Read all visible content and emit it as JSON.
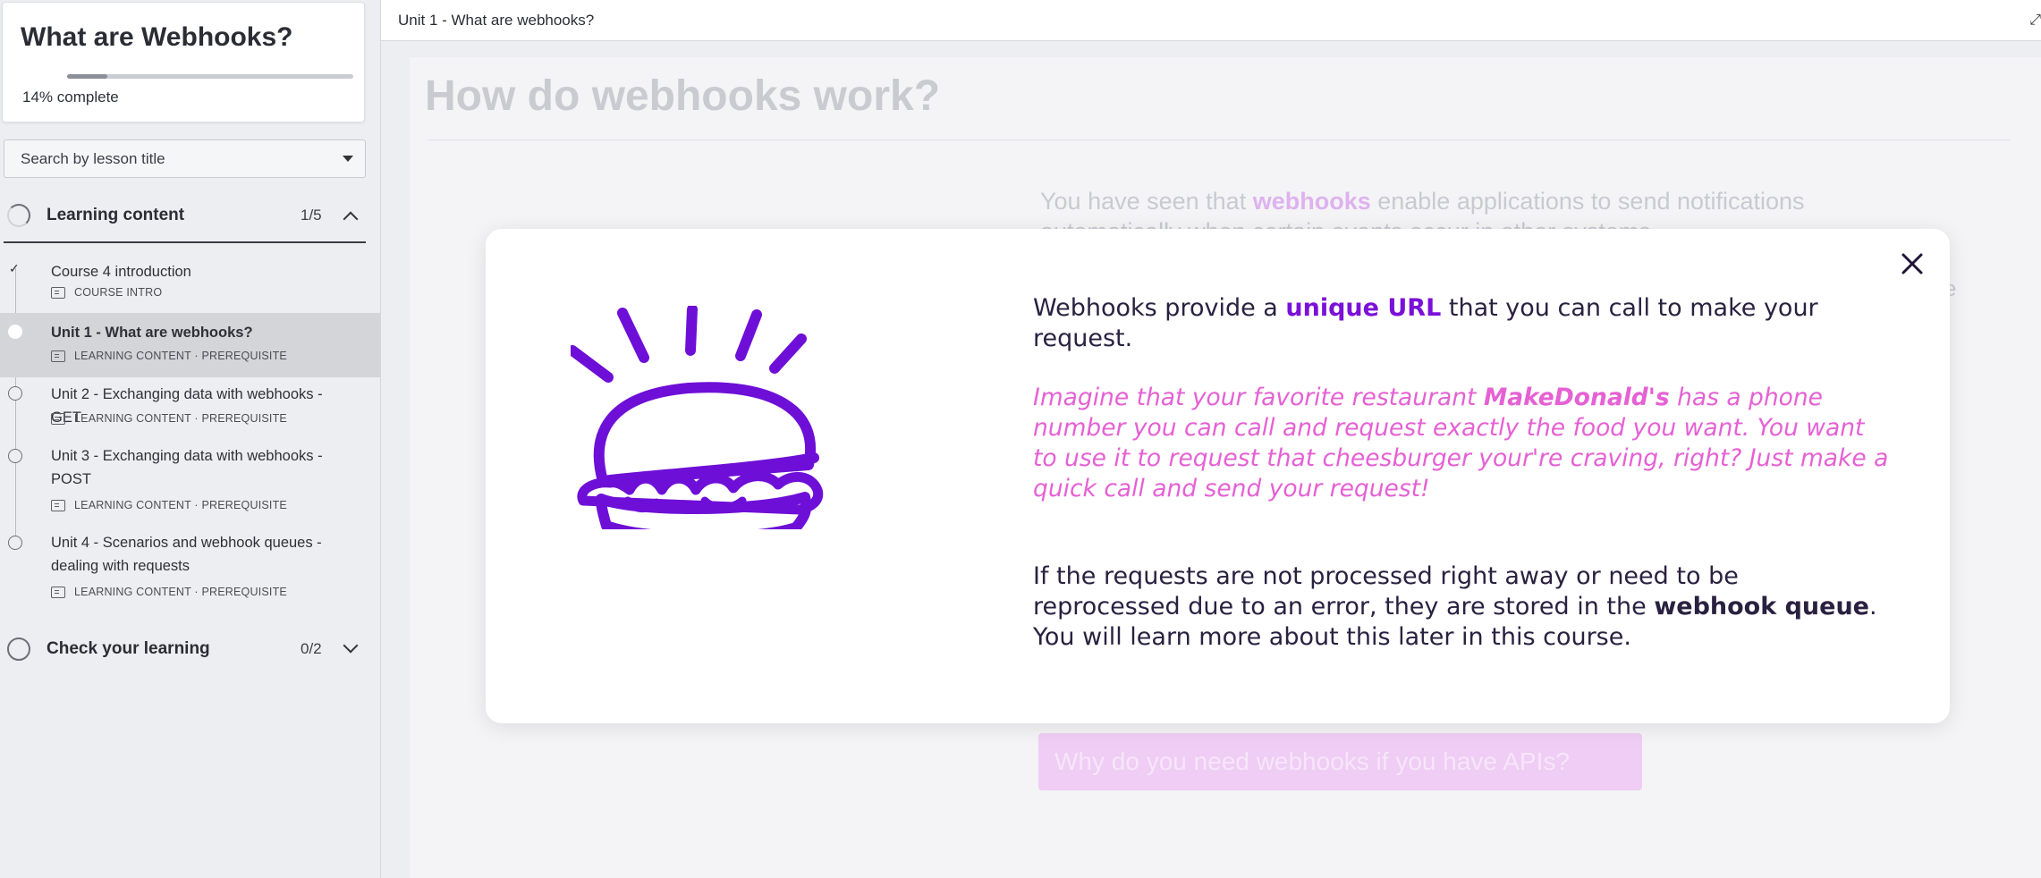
{
  "sidebar": {
    "course_title": "What are Webhooks?",
    "progress_percent_label": "14%",
    "progress_suffix": "complete",
    "progress_fraction": 0.14,
    "search_placeholder": "Search by lesson title",
    "sections": [
      {
        "label": "Learning content",
        "count": "1/5"
      },
      {
        "label": "Check your learning",
        "count": "0/2"
      }
    ],
    "lessons": [
      {
        "title": "Course 4 introduction",
        "meta": "COURSE INTRO",
        "state": "complete"
      },
      {
        "title": "Unit 1 - What are webhooks?",
        "meta": "LEARNING CONTENT · PREREQUISITE",
        "state": "active"
      },
      {
        "title": "Unit 2 - Exchanging data with webhooks - GET",
        "meta": "LEARNING CONTENT · PREREQUISITE",
        "state": "todo"
      },
      {
        "title": "Unit 3 - Exchanging data with webhooks - POST",
        "meta": "LEARNING CONTENT · PREREQUISITE",
        "state": "todo"
      },
      {
        "title": "Unit 4 - Scenarios and webhook queues - dealing with requests",
        "meta": "LEARNING CONTENT · PREREQUISITE",
        "state": "todo"
      }
    ]
  },
  "topbar": {
    "breadcrumb": "Unit 1 - What are webhooks?"
  },
  "background": {
    "heading": "How do webhooks work?",
    "intro_before": "You have seen that ",
    "intro_highlight": "webhooks",
    "intro_after": " enable applications to send notifications",
    "intro_line2": "automatically when certain events occur in other systems.",
    "fragment": "e",
    "button_label": "Why do you need webhooks if you have APIs?"
  },
  "modal": {
    "p1_before": "Webhooks provide a ",
    "p1_highlight": "unique URL",
    "p1_after": " that you can call to make your request.",
    "p2_before": "Imagine that your favorite restaurant ",
    "p2_brand": "MakeDonald's",
    "p2_after": " has a phone number you can call and request exactly the food you want. You want to use it to request that cheesburger your're craving, right? Just make a quick call and send your request!",
    "p3_before": "If the requests are not processed right away or need to be reprocessed due to an error, they are stored in the ",
    "p3_bold": "webhook queue",
    "p3_after": ". You will learn more about this later in this course.",
    "illustration_icon": "burger-icon",
    "close_icon": "close-icon"
  },
  "colors": {
    "accent_purple": "#7b10d8",
    "accent_pink": "#e561d4"
  }
}
